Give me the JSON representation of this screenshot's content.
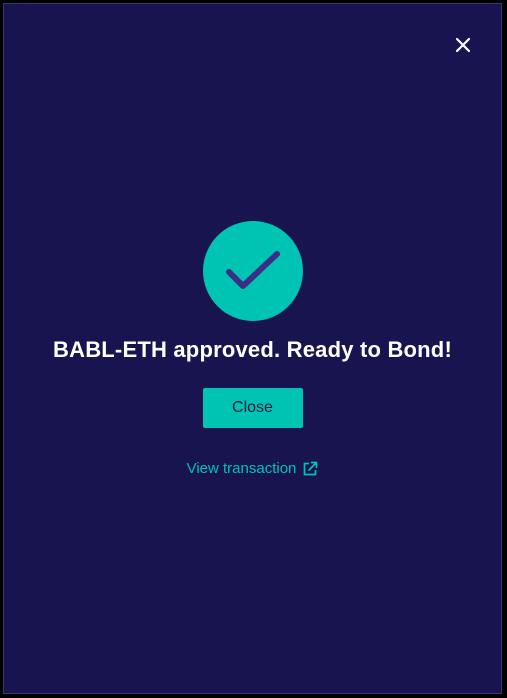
{
  "modal": {
    "close_icon": "close-icon",
    "success_icon": "checkmark-icon",
    "title": "BABL-ETH approved. Ready to Bond!",
    "close_button_label": "Close",
    "view_transaction_label": "View transaction",
    "external_link_icon": "external-link-icon"
  },
  "colors": {
    "background": "#181450",
    "accent": "#00C4B3",
    "checkmark": "#3B2E86",
    "text": "#FFFFFF"
  }
}
